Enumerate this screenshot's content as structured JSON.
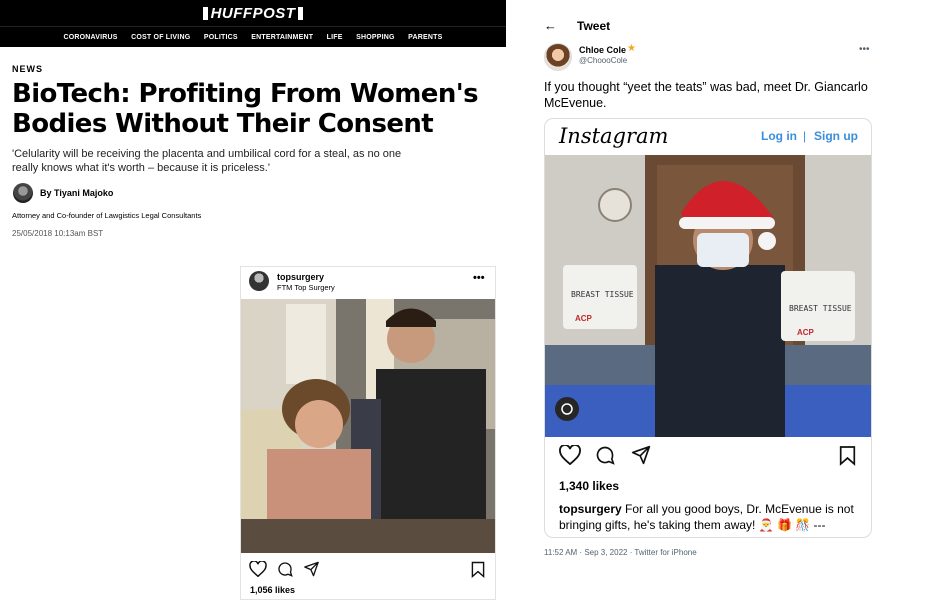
{
  "huffpost": {
    "logo": "HUFFPOST",
    "nav": [
      "CORONAVIRUS",
      "COST OF LIVING",
      "POLITICS",
      "ENTERTAINMENT",
      "LIFE",
      "SHOPPING",
      "PARENTS"
    ],
    "section": "NEWS",
    "headline": "BioTech: Profiting From Women's Bodies Without Their Consent",
    "standfirst": "'Celularity will be receiving the placenta and umbilical cord for a steal, as no one really knows what it's worth – because it is priceless.'",
    "author": "By Tiyani Majoko",
    "author_role": "Attorney and Co-founder of Lawgistics Legal Consultants",
    "date": "25/05/2018 10:13am BST",
    "instagram": {
      "username": "topsurgery",
      "location": "FTM Top Surgery",
      "likes": "1,056 likes"
    }
  },
  "tweet": {
    "header_title": "Tweet",
    "name": "Chloe Cole",
    "handle": "@ChoooCole",
    "text": "If you thought “yeet the teats” was bad, meet Dr. Giancarlo McEvenue.",
    "timestamp": "11:52 AM · Sep 3, 2022 · Twitter for iPhone",
    "instagram": {
      "brand": "Instagram",
      "login": "Log in",
      "separator": "|",
      "signup": "Sign up",
      "likes": "1,340 likes",
      "caption_user": "topsurgery",
      "caption_text": " For all you good boys, Dr. McEvenue is not bringing gifts, he's taking them away! 🎅 🎁 🎊 ---"
    },
    "bucket_labels": [
      "BREAST TISSUE",
      "ACP"
    ]
  },
  "colors": {
    "link_blue": "#3a8edb",
    "verified_star": "#f5a623",
    "huffpost_bar": "#000000"
  }
}
